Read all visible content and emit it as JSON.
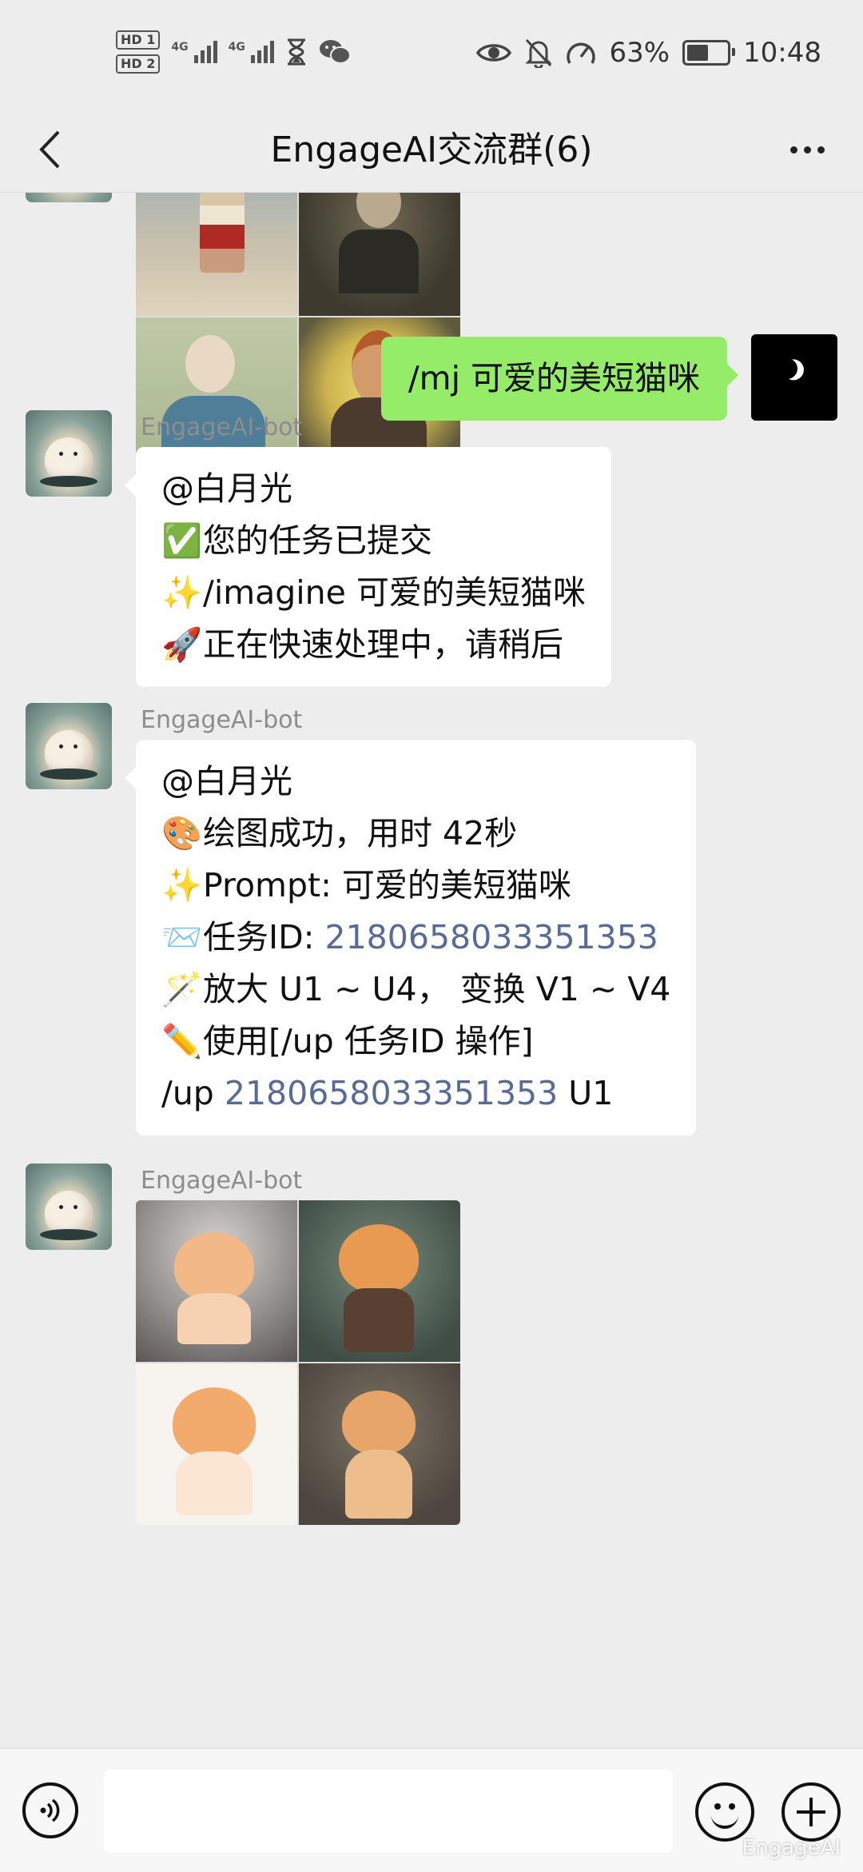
{
  "status_bar": {
    "hd1": "HD 1",
    "hd2": "HD 2",
    "net1": "4G",
    "net2": "4G",
    "battery_percent": "63%",
    "battery_level": 0.63,
    "time": "10:48",
    "icons": [
      "hourglass-icon",
      "wechat-icon",
      "eye-icon",
      "mute-bell-icon",
      "speedometer-icon"
    ]
  },
  "nav": {
    "title": "EngageAI交流群(6)",
    "back_icon": "chevron-left-icon",
    "more_icon": "more-dots-icon"
  },
  "messages": [
    {
      "from": "bot",
      "type": "image-grid",
      "content": "4 portraits of boys (partially scrolled)"
    },
    {
      "from": "me",
      "type": "text",
      "text": "/mj 可爱的美短猫咪"
    },
    {
      "from": "bot",
      "sender": "EngageAI-bot",
      "type": "text",
      "lines": [
        {
          "emoji": "",
          "text": "@白月光"
        },
        {
          "emoji": "✅",
          "text": "您的任务已提交"
        },
        {
          "emoji": "✨",
          "text": "/imagine 可爱的美短猫咪"
        },
        {
          "emoji": "🚀",
          "text": "正在快速处理中，请稍后"
        }
      ]
    },
    {
      "from": "bot",
      "sender": "EngageAI-bot",
      "type": "text",
      "line1": "@白月光",
      "line2": {
        "emoji": "🎨",
        "text": "绘图成功，用时 42秒"
      },
      "line3": {
        "emoji": "✨",
        "text": "Prompt: 可爱的美短猫咪"
      },
      "line4": {
        "emoji": "📨",
        "label": "任务ID: ",
        "task_id": "2180658033351353"
      },
      "line5": {
        "emoji": "🪄",
        "text": "放大 U1 ~ U4， 变换 V1 ~ V4"
      },
      "line6": {
        "emoji": "✏️",
        "text": "使用[/up 任务ID 操作]"
      },
      "line7": {
        "prefix": "/up ",
        "task_id": "2180658033351353",
        "suffix": " U1"
      }
    },
    {
      "from": "bot",
      "sender": "EngageAI-bot",
      "type": "image-grid",
      "content": "4 cute orange kittens"
    }
  ],
  "input_bar": {
    "placeholder": "",
    "voice_icon": "voice-icon",
    "emoji_icon": "emoji-icon",
    "plus_icon": "plus-icon",
    "watermark": "EngageAI"
  }
}
